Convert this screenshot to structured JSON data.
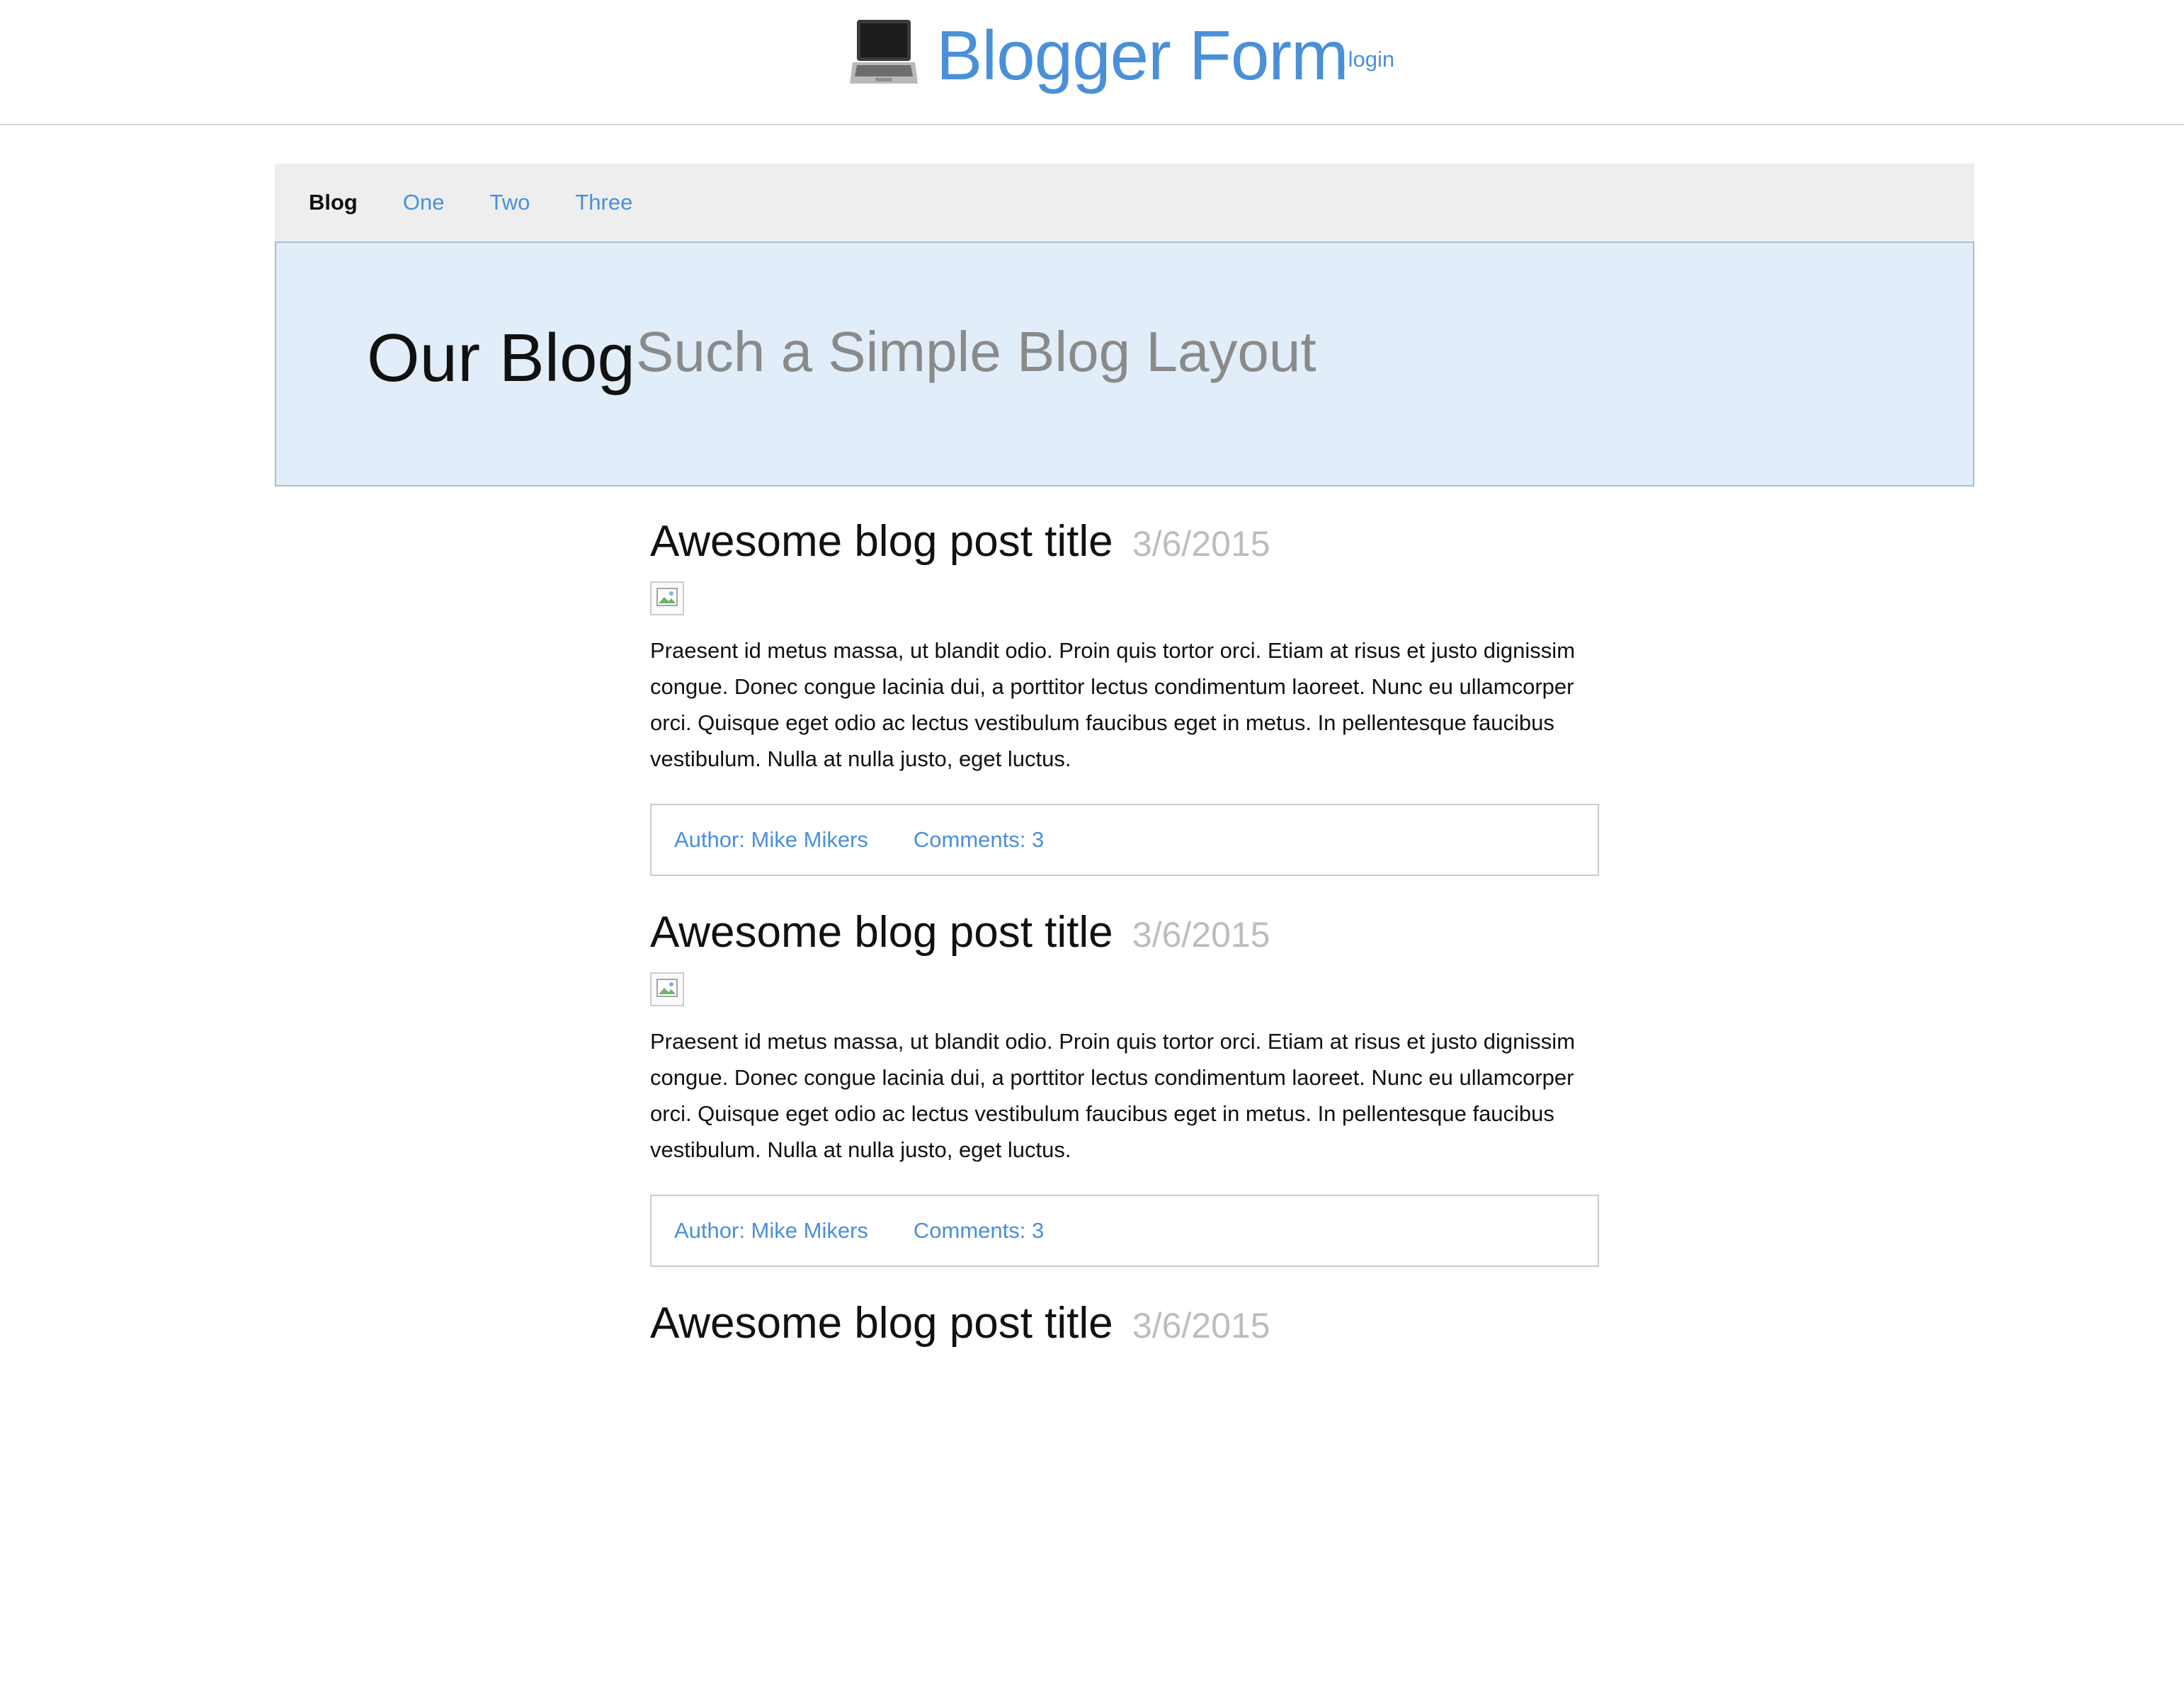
{
  "header": {
    "icon": "laptop-icon",
    "title": "Blogger Form",
    "login_label": "login"
  },
  "nav": {
    "items": [
      {
        "label": "Blog",
        "active": true
      },
      {
        "label": "One",
        "active": false
      },
      {
        "label": "Two",
        "active": false
      },
      {
        "label": "Three",
        "active": false
      }
    ]
  },
  "hero": {
    "title": "Our Blog",
    "subtitle": "Such a Simple Blog Layout"
  },
  "posts": [
    {
      "title": "Awesome blog post title",
      "date": "3/6/2015",
      "image_icon": "broken-image-icon",
      "body": "Praesent id metus massa, ut blandit odio. Proin quis tortor orci. Etiam at risus et justo dignissim congue. Donec congue lacinia dui, a porttitor lectus condimentum laoreet. Nunc eu ullamcorper orci. Quisque eget odio ac lectus vestibulum faucibus eget in metus. In pellentesque faucibus vestibulum. Nulla at nulla justo, eget luctus.",
      "author": "Author: Mike Mikers",
      "comments": "Comments: 3"
    },
    {
      "title": "Awesome blog post title",
      "date": "3/6/2015",
      "image_icon": "broken-image-icon",
      "body": "Praesent id metus massa, ut blandit odio. Proin quis tortor orci. Etiam at risus et justo dignissim congue. Donec congue lacinia dui, a porttitor lectus condimentum laoreet. Nunc eu ullamcorper orci. Quisque eget odio ac lectus vestibulum faucibus eget in metus. In pellentesque faucibus vestibulum. Nulla at nulla justo, eget luctus.",
      "author": "Author: Mike Mikers",
      "comments": "Comments: 3"
    },
    {
      "title": "Awesome blog post title",
      "date": "3/6/2015"
    }
  ],
  "colors": {
    "link": "#4a90d9",
    "hero_background": "#e1edf9",
    "nav_background": "#eeeeee",
    "date_text": "#bdbdbd",
    "subtitle_text": "#8a8a8a"
  }
}
